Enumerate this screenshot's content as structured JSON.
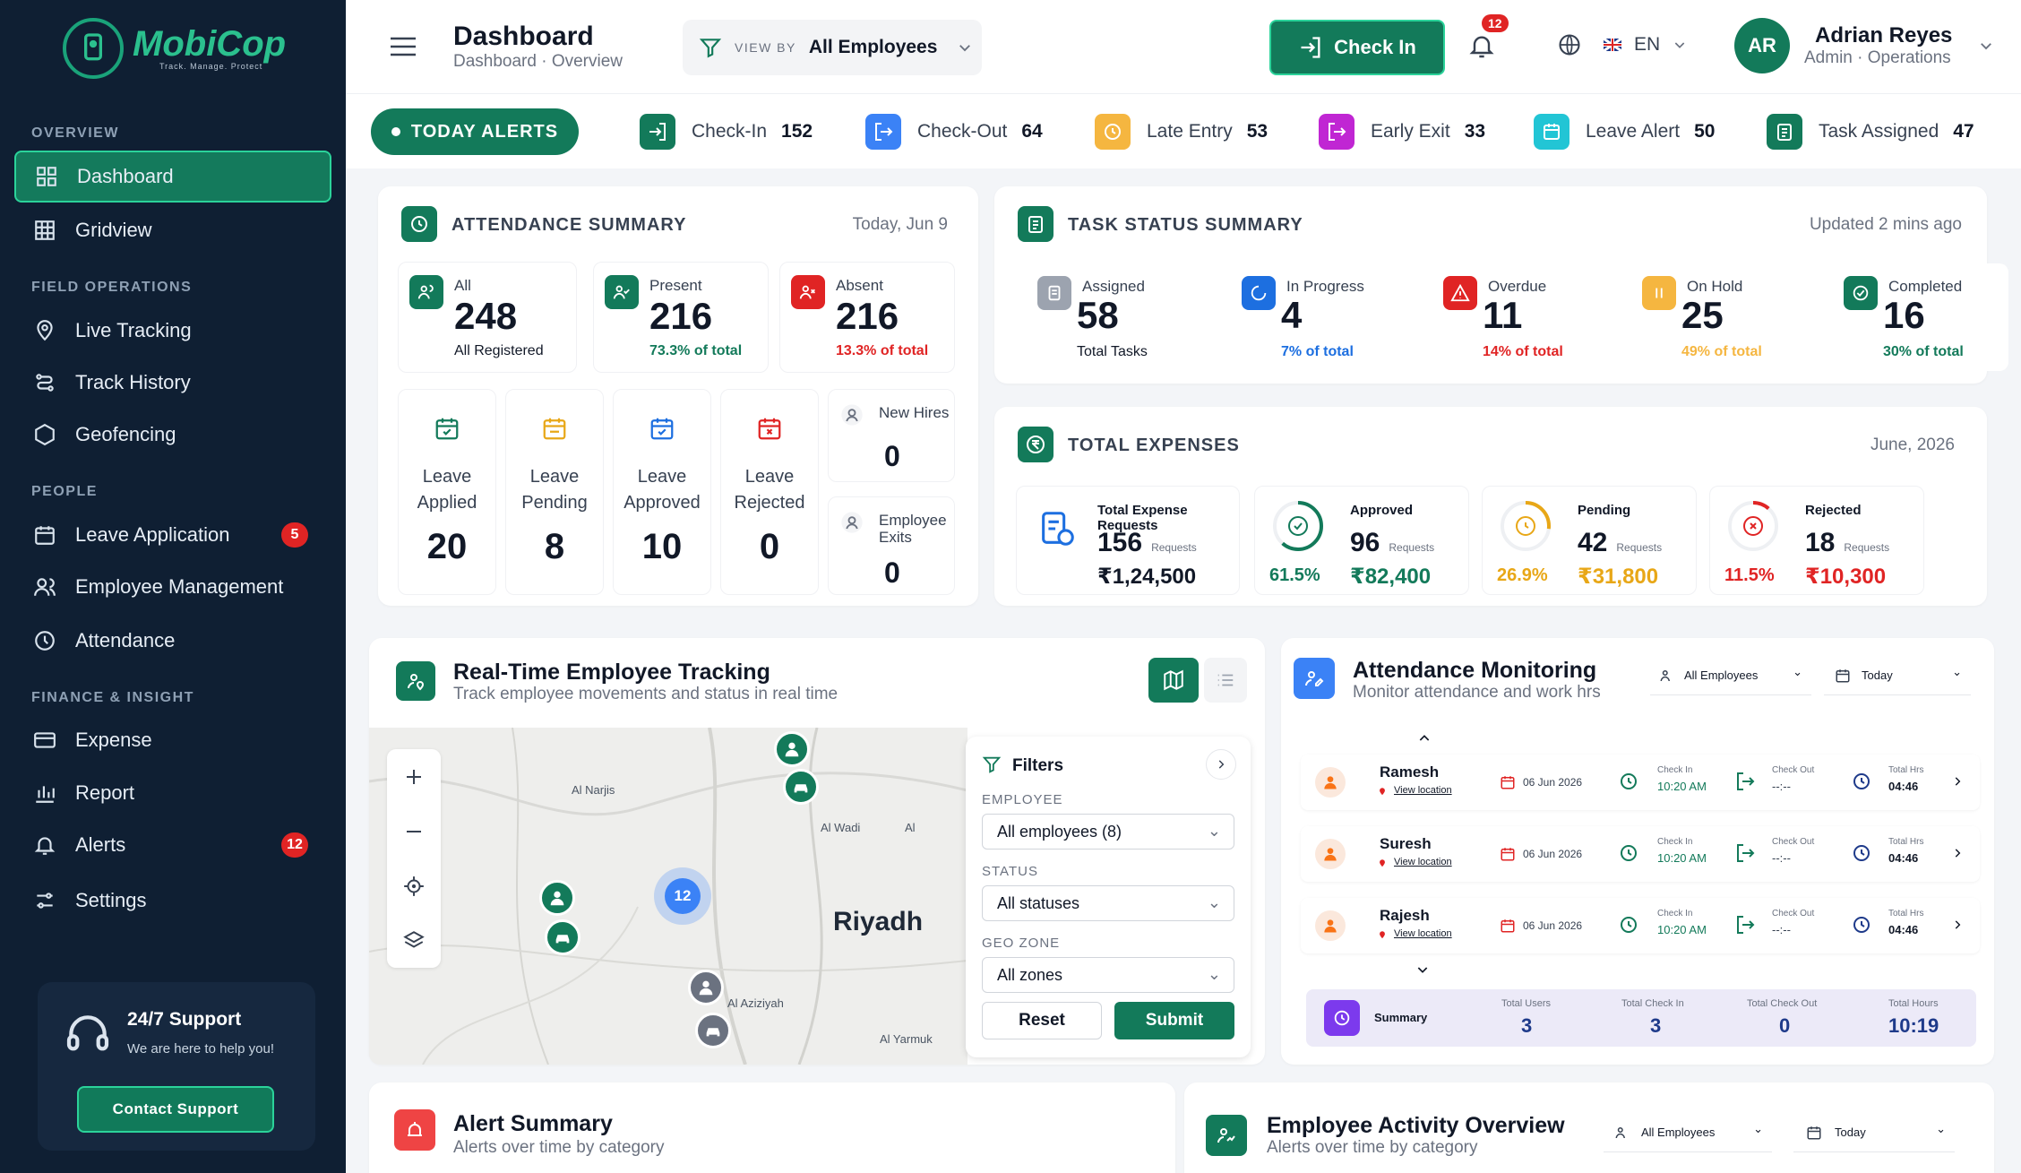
{
  "brand": {
    "name": "MobiCop",
    "tagline": "Track. Manage. Protect"
  },
  "sidebar": {
    "sections": {
      "overview": "OVERVIEW",
      "field": "FIELD OPERATIONS",
      "people": "PEOPLE",
      "finance": "FINANCE & INSIGHT"
    },
    "items": {
      "dashboard": "Dashboard",
      "gridview": "Gridview",
      "live": "Live Tracking",
      "history": "Track History",
      "geofencing": "Geofencing",
      "leave": "Leave Application",
      "employee": "Employee Management",
      "attendance": "Attendance",
      "expense": "Expense",
      "report": "Report",
      "alerts": "Alerts",
      "settings": "Settings"
    },
    "badges": {
      "leave": "5",
      "alerts": "12"
    },
    "support": {
      "title": "24/7 Support",
      "sub": "We are here to help you!",
      "button": "Contact Support"
    }
  },
  "header": {
    "title": "Dashboard",
    "breadcrumb": "Dashboard · Overview",
    "viewby_label": "VIEW BY",
    "viewby_value": "All Employees",
    "checkin": "Check In",
    "notif_count": "12",
    "lang": "EN",
    "avatar": "AR",
    "user": "Adrian Reyes",
    "role": "Admin · Operations"
  },
  "alerts": {
    "today": "TODAY ALERTS",
    "items": [
      {
        "label": "Check-In",
        "value": "152",
        "color": "#137a5a"
      },
      {
        "label": "Check-Out",
        "value": "64",
        "color": "#3b82f6"
      },
      {
        "label": "Late Entry",
        "value": "53",
        "color": "#f5b640"
      },
      {
        "label": "Early Exit",
        "value": "33",
        "color": "#c026d3"
      },
      {
        "label": "Leave Alert",
        "value": "50",
        "color": "#22c5d5"
      },
      {
        "label": "Task Assigned",
        "value": "47",
        "color": "#137a5a"
      }
    ]
  },
  "attendance": {
    "title": "ATTENDANCE SUMMARY",
    "date": "Today, Jun 9",
    "all": {
      "label": "All",
      "value": "248",
      "sub": "All Registered"
    },
    "present": {
      "label": "Present",
      "value": "216",
      "sub": "73.3% of total"
    },
    "absent": {
      "label": "Absent",
      "value": "216",
      "sub": "13.3% of total"
    },
    "tiles": [
      {
        "l1": "Leave",
        "l2": "Applied",
        "v": "20"
      },
      {
        "l1": "Leave",
        "l2": "Pending",
        "v": "8"
      },
      {
        "l1": "Leave",
        "l2": "Approved",
        "v": "10"
      },
      {
        "l1": "Leave",
        "l2": "Rejected",
        "v": "0"
      }
    ],
    "newhires": {
      "label": "New Hires",
      "value": "0"
    },
    "exits": {
      "l1": "Employee",
      "l2": "Exits",
      "value": "0"
    }
  },
  "tasks": {
    "title": "TASK STATUS SUMMARY",
    "updated": "Updated 2 mins ago",
    "items": [
      {
        "label": "Assigned",
        "value": "58",
        "sub": "Total Tasks",
        "color": "#9ca3af"
      },
      {
        "label": "In Progress",
        "value": "4",
        "sub": "7% of total",
        "color": "#1d6fe0"
      },
      {
        "label": "Overdue",
        "value": "11",
        "sub": "14% of total",
        "color": "#e02424"
      },
      {
        "label": "On Hold",
        "value": "25",
        "sub": "49% of total",
        "color": "#f5b640"
      },
      {
        "label": "Completed",
        "value": "16",
        "sub": "30% of total",
        "color": "#137a5a"
      }
    ]
  },
  "expenses": {
    "title": "TOTAL EXPENSES",
    "date": "June, 2026",
    "total": {
      "label": "Total Expense Requests",
      "count": "156",
      "unit": "Requests",
      "amount": "₹1,24,500"
    },
    "approved": {
      "label": "Approved",
      "count": "96",
      "unit": "Requests",
      "amount": "₹82,400",
      "pct": "61.5%",
      "frac": 0.615,
      "color": "#137a5a"
    },
    "pending": {
      "label": "Pending",
      "count": "42",
      "unit": "Requests",
      "amount": "₹31,800",
      "pct": "26.9%",
      "frac": 0.269,
      "color": "#e8a717"
    },
    "rejected": {
      "label": "Rejected",
      "count": "18",
      "unit": "Requests",
      "amount": "₹10,300",
      "pct": "11.5%",
      "frac": 0.115,
      "color": "#e02424"
    }
  },
  "tracking": {
    "title": "Real-Time Employee Tracking",
    "sub": "Track employee movements and status in real time",
    "map": {
      "city": "Riyadh",
      "areas": {
        "narjis": "Al Narjis",
        "wadi": "Al Wadi",
        "al": "Al",
        "aziziyah": "Al Aziziyah",
        "yarmuk": "Al Yarmuk"
      },
      "cluster": "12"
    },
    "filters": {
      "title": "Filters",
      "employee_label": "EMPLOYEE",
      "employee": "All employees (8)",
      "status_label": "STATUS",
      "status": "All statuses",
      "zone_label": "GEO ZONE",
      "zone": "All zones",
      "reset": "Reset",
      "submit": "Submit"
    }
  },
  "monitoring": {
    "title": "Attendance Monitoring",
    "sub": "Monitor attendance and work hrs",
    "filter": "All Employees",
    "period": "Today",
    "labels": {
      "checkin": "Check In",
      "checkout": "Check Out",
      "total": "Total Hrs",
      "view": "View location"
    },
    "rows": [
      {
        "name": "Ramesh",
        "date": "06 Jun 2026",
        "in": "10:20 AM",
        "out": "--:--",
        "hrs": "04:46"
      },
      {
        "name": "Suresh",
        "date": "06 Jun 2026",
        "in": "10:20 AM",
        "out": "--:--",
        "hrs": "04:46"
      },
      {
        "name": "Rajesh",
        "date": "06 Jun 2026",
        "in": "10:20 AM",
        "out": "--:--",
        "hrs": "04:46"
      }
    ],
    "summary": {
      "label": "Summary",
      "users_l": "Total Users",
      "users": "3",
      "in_l": "Total Check In",
      "in": "3",
      "out_l": "Total Check Out",
      "out": "0",
      "hrs_l": "Total Hours",
      "hrs": "10:19"
    }
  },
  "alertsummary": {
    "title": "Alert Summary",
    "sub": "Alerts over time by category"
  },
  "activity": {
    "title": "Employee Activity Overview",
    "sub": "Alerts over time by category",
    "filter": "All Employees",
    "period": "Today"
  }
}
